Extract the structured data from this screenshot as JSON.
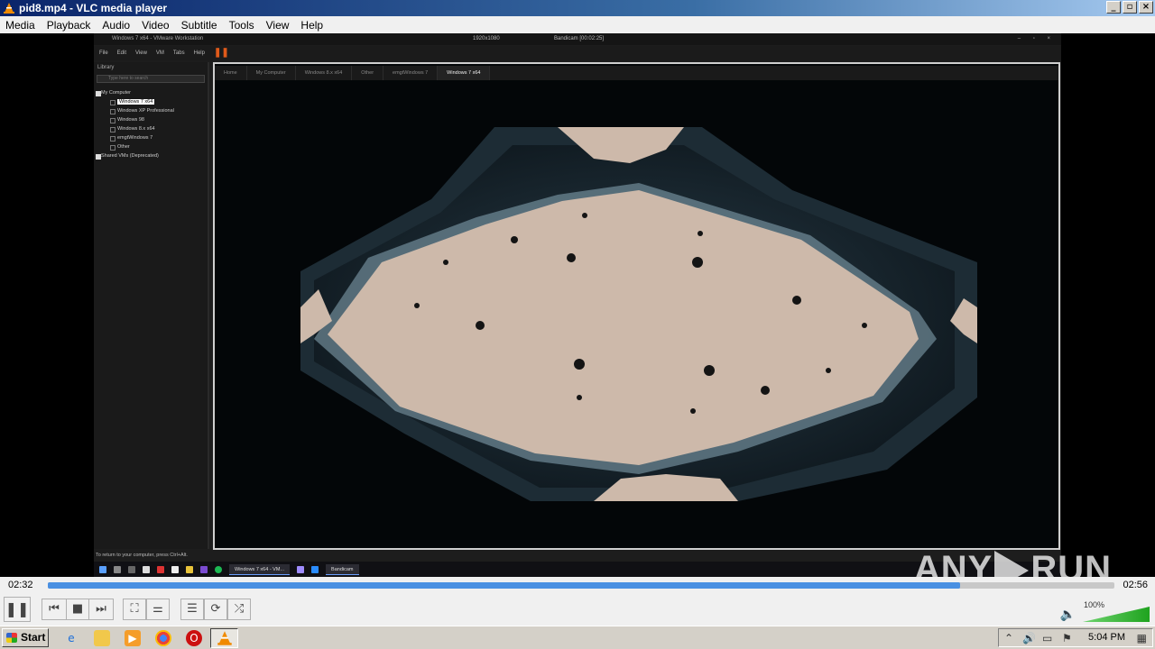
{
  "window": {
    "title": "pid8.mp4 - VLC media player"
  },
  "menu": [
    "Media",
    "Playback",
    "Audio",
    "Video",
    "Subtitle",
    "Tools",
    "View",
    "Help"
  ],
  "vmware": {
    "title": "Windows 7 x64 - VMware Workstation",
    "status_resolution": "1920x1080",
    "status_recording": "Bandicam [00:02:25]",
    "menu": [
      "File",
      "Edit",
      "View",
      "VM",
      "Tabs",
      "Help"
    ],
    "library_label": "Library",
    "search_placeholder": "Type here to search",
    "tree": [
      "My Computer",
      "Windows 7 x64",
      "Windows XP Professional",
      "Windows 98",
      "Windows 8.x x64",
      "emgtWindows 7",
      "Other",
      "Shared VMs (Deprecated)"
    ],
    "tabs": [
      "Home",
      "My Computer",
      "Windows 8.x x64",
      "Other",
      "emgtWindows 7",
      "Windows 7 x64"
    ],
    "hint": "To return to your computer, press Ctrl+Alt.",
    "guest_tasks": [
      "Windows 7 x64 - VM...",
      "Bandicam"
    ]
  },
  "watermark": {
    "left": "ANY",
    "right": "RUN"
  },
  "playback": {
    "current": "02:32",
    "total": "02:56",
    "progress": 0.855
  },
  "controls": {
    "pause": "❚❚",
    "prev": "⏮",
    "stop": "■",
    "next": "⏭",
    "fullscreen": "⛶",
    "extended": "⚌",
    "playlist": "☰",
    "loop": "⟳",
    "shuffle": "⤮"
  },
  "volume": {
    "label": "100%",
    "level": 1.0
  },
  "taskbar": {
    "start": "Start",
    "clock": "5:04 PM"
  }
}
